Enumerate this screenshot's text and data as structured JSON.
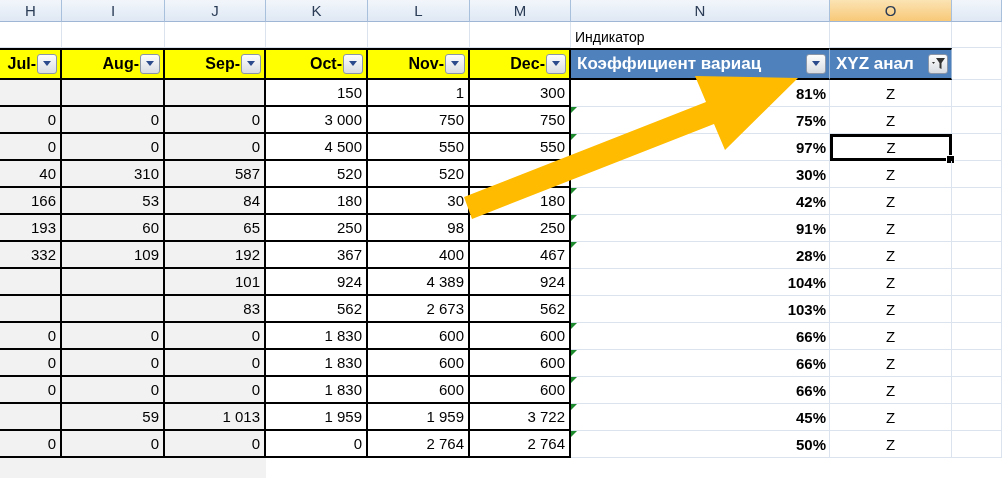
{
  "column_letters": [
    {
      "label": "H",
      "selected": false
    },
    {
      "label": "I",
      "selected": false
    },
    {
      "label": "J",
      "selected": false
    },
    {
      "label": "K",
      "selected": false
    },
    {
      "label": "L",
      "selected": false
    },
    {
      "label": "M",
      "selected": false
    },
    {
      "label": "N",
      "selected": false
    },
    {
      "label": "O",
      "selected": true
    }
  ],
  "caption": "Индикатор",
  "headers": [
    {
      "label": "Jul-",
      "kind": "month",
      "filtered": false
    },
    {
      "label": "Aug-",
      "kind": "month",
      "filtered": false
    },
    {
      "label": "Sep-",
      "kind": "month",
      "filtered": false
    },
    {
      "label": "Oct-",
      "kind": "month",
      "filtered": false
    },
    {
      "label": "Nov-",
      "kind": "month",
      "filtered": false
    },
    {
      "label": "Dec-",
      "kind": "month",
      "filtered": false
    },
    {
      "label": "Коэффициент вариац",
      "kind": "metric",
      "filtered": false
    },
    {
      "label": "XYZ анал",
      "kind": "metric",
      "filtered": true
    }
  ],
  "rows": [
    {
      "cells": [
        "",
        "",
        "",
        "150",
        "1",
        "300"
      ],
      "flag": false,
      "coefficient": "81%",
      "xyz": "Z",
      "selected": false
    },
    {
      "cells": [
        "0",
        "0",
        "0",
        "3 000",
        "750",
        "750"
      ],
      "flag": true,
      "coefficient": "75%",
      "xyz": "Z",
      "selected": false
    },
    {
      "cells": [
        "0",
        "0",
        "0",
        "4 500",
        "550",
        "550"
      ],
      "flag": true,
      "coefficient": "97%",
      "xyz": "Z",
      "selected": true
    },
    {
      "cells": [
        "40",
        "310",
        "587",
        "520",
        "520",
        ""
      ],
      "flag": false,
      "coefficient": "30%",
      "xyz": "Z",
      "selected": false
    },
    {
      "cells": [
        "166",
        "53",
        "84",
        "180",
        "30",
        "180"
      ],
      "flag": true,
      "coefficient": "42%",
      "xyz": "Z",
      "selected": false
    },
    {
      "cells": [
        "193",
        "60",
        "65",
        "250",
        "98",
        "250"
      ],
      "flag": true,
      "coefficient": "91%",
      "xyz": "Z",
      "selected": false
    },
    {
      "cells": [
        "332",
        "109",
        "192",
        "367",
        "400",
        "467"
      ],
      "flag": true,
      "coefficient": "28%",
      "xyz": "Z",
      "selected": false
    },
    {
      "cells": [
        "",
        "",
        "101",
        "924",
        "4 389",
        "924"
      ],
      "flag": false,
      "coefficient": "104%",
      "xyz": "Z",
      "selected": false
    },
    {
      "cells": [
        "",
        "",
        "83",
        "562",
        "2 673",
        "562"
      ],
      "flag": false,
      "coefficient": "103%",
      "xyz": "Z",
      "selected": false
    },
    {
      "cells": [
        "0",
        "0",
        "0",
        "1 830",
        "600",
        "600"
      ],
      "flag": true,
      "coefficient": "66%",
      "xyz": "Z",
      "selected": false
    },
    {
      "cells": [
        "0",
        "0",
        "0",
        "1 830",
        "600",
        "600"
      ],
      "flag": true,
      "coefficient": "66%",
      "xyz": "Z",
      "selected": false
    },
    {
      "cells": [
        "0",
        "0",
        "0",
        "1 830",
        "600",
        "600"
      ],
      "flag": true,
      "coefficient": "66%",
      "xyz": "Z",
      "selected": false
    },
    {
      "cells": [
        "",
        "59",
        "1 013",
        "1 959",
        "1 959",
        "3 722"
      ],
      "flag": true,
      "coefficient": "45%",
      "xyz": "Z",
      "selected": false
    },
    {
      "cells": [
        "0",
        "0",
        "0",
        "0",
        "2 764",
        "2 764"
      ],
      "flag": true,
      "coefficient": "50%",
      "xyz": "Z",
      "selected": false
    }
  ]
}
